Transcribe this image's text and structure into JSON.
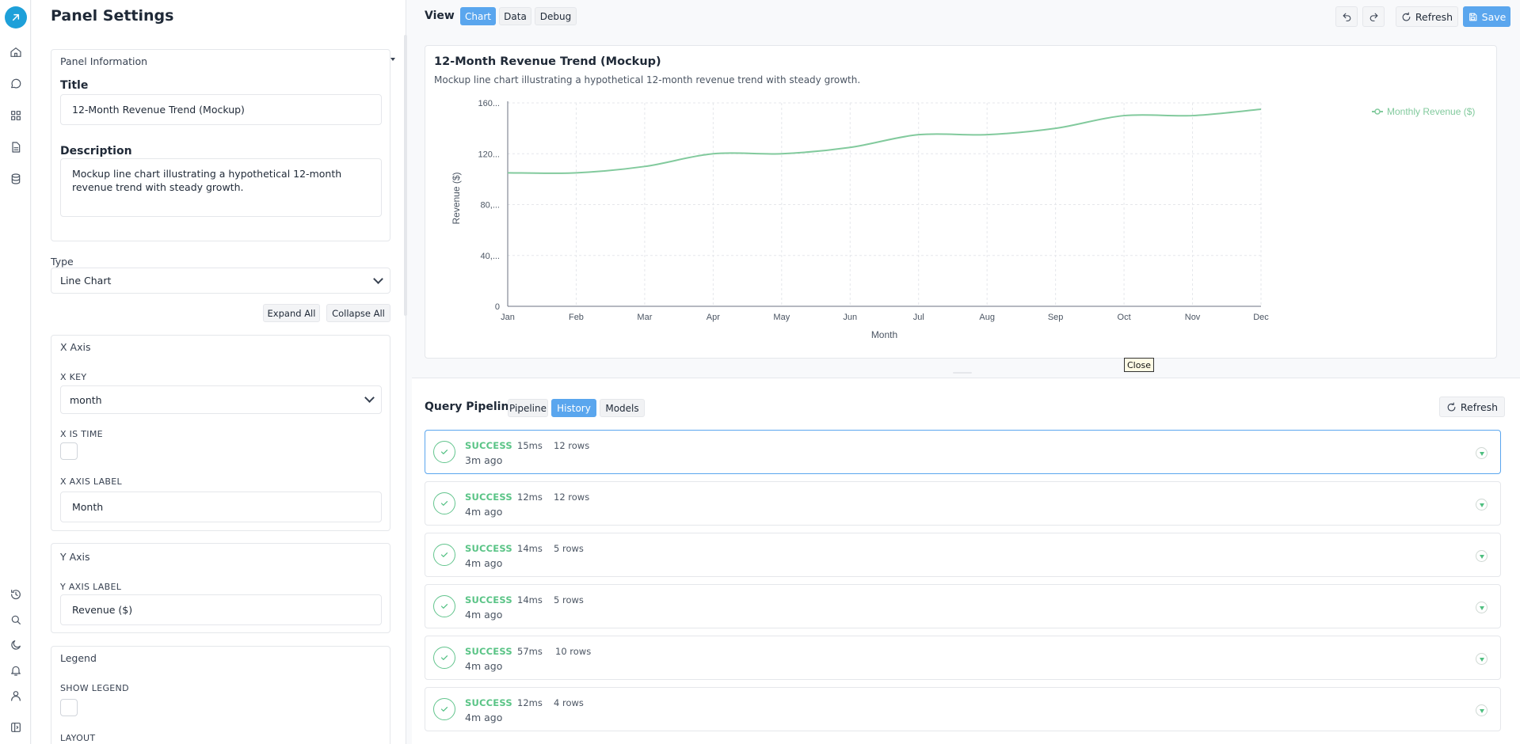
{
  "settings": {
    "title": "Panel Settings",
    "panel_info": {
      "header": "Panel Information",
      "title_label": "Title",
      "title_value": "12-Month Revenue Trend (Mockup)",
      "description_label": "Description",
      "description_value": "Mockup line chart illustrating a hypothetical 12-month revenue trend with steady growth."
    },
    "type_label": "Type",
    "type_value": "Line Chart",
    "expand_all": "Expand All",
    "collapse_all": "Collapse All",
    "x_axis": {
      "header": "X Axis",
      "key_label": "X KEY",
      "key_value": "month",
      "is_time_label": "X IS TIME",
      "axis_label_label": "X AXIS LABEL",
      "axis_label_value": "Month"
    },
    "y_axis": {
      "header": "Y Axis",
      "axis_label_label": "Y AXIS LABEL",
      "axis_label_value": "Revenue ($)"
    },
    "legend": {
      "header": "Legend",
      "show_legend_label": "SHOW LEGEND",
      "layout_label": "LAYOUT"
    }
  },
  "view": {
    "label": "View",
    "tabs": [
      {
        "label": "Chart",
        "active": true
      },
      {
        "label": "Data",
        "active": false
      },
      {
        "label": "Debug",
        "active": false
      }
    ],
    "refresh_label": "Refresh",
    "save_label": "Save"
  },
  "chart_panel": {
    "title": "12-Month Revenue Trend (Mockup)",
    "description": "Mockup line chart illustrating a hypothetical 12-month revenue trend with steady growth.",
    "tooltip": "Close"
  },
  "chart_data": {
    "type": "line",
    "categories": [
      "Jan",
      "Feb",
      "Mar",
      "Apr",
      "May",
      "Jun",
      "Jul",
      "Aug",
      "Sep",
      "Oct",
      "Nov",
      "Dec"
    ],
    "series": [
      {
        "name": "Monthly Revenue ($)",
        "values": [
          105000,
          105000,
          110000,
          120000,
          120000,
          125000,
          135000,
          135000,
          140000,
          150000,
          150000,
          155000
        ],
        "color": "#82ca9d"
      }
    ],
    "xlabel": "Month",
    "ylabel": "Revenue ($)",
    "yticks": [
      "0",
      "40,...",
      "80,...",
      "120...",
      "160..."
    ],
    "ylim": [
      0,
      160000
    ],
    "grid": true,
    "legend_position": "top-right"
  },
  "pipeline": {
    "label": "Query Pipeline",
    "tabs": [
      {
        "label": "Pipeline",
        "active": false
      },
      {
        "label": "History",
        "active": true
      },
      {
        "label": "Models",
        "active": false
      }
    ],
    "refresh_label": "Refresh",
    "runs": [
      {
        "status": "SUCCESS",
        "duration": "15ms",
        "rows": "12 rows",
        "ago": "3m ago"
      },
      {
        "status": "SUCCESS",
        "duration": "12ms",
        "rows": "12 rows",
        "ago": "4m ago"
      },
      {
        "status": "SUCCESS",
        "duration": "14ms",
        "rows": "5 rows",
        "ago": "4m ago"
      },
      {
        "status": "SUCCESS",
        "duration": "14ms",
        "rows": "5 rows",
        "ago": "4m ago"
      },
      {
        "status": "SUCCESS",
        "duration": "57ms",
        "rows": "10 rows",
        "ago": "4m ago"
      },
      {
        "status": "SUCCESS",
        "duration": "12ms",
        "rows": "4 rows",
        "ago": "4m ago"
      }
    ]
  },
  "colors": {
    "accent": "#5aa6ee",
    "success": "#5ac486",
    "series": "#82ca9d"
  }
}
